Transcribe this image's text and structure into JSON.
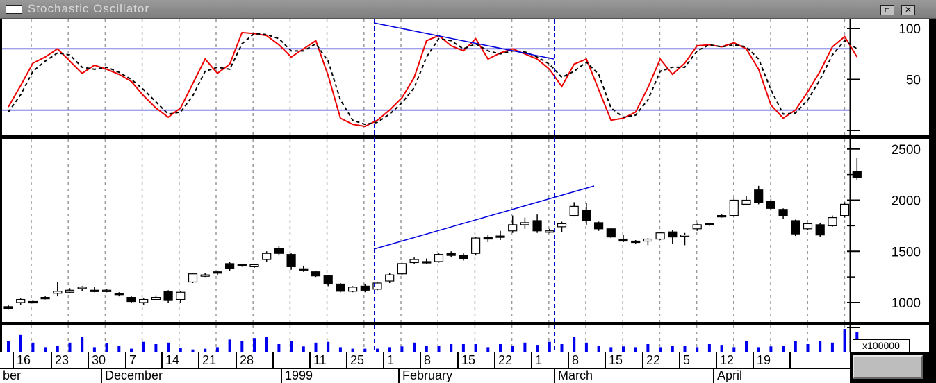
{
  "window": {
    "title": "Stochastic Oscillator",
    "restore_symbol": "▫",
    "close_symbol": "✕"
  },
  "colors": {
    "k_line": "#ee0000",
    "d_line": "#000000",
    "levels": "#0000cc",
    "trendline": "#0000dd",
    "volume": "#0000ee",
    "grid": "#9a9a9a"
  },
  "date_axis": {
    "days": [
      "16",
      "23",
      "30",
      "7",
      "14",
      "21",
      "28",
      "",
      "11",
      "25",
      "1",
      "8",
      "15",
      "22",
      "1",
      "8",
      "15",
      "22",
      "5",
      "12",
      "19",
      ""
    ],
    "months": [
      "ber",
      "December",
      "1999",
      "February",
      "March",
      "April"
    ]
  },
  "volume_unit": "x100000",
  "chart_data": [
    {
      "type": "line",
      "xlabel": "",
      "ylabel": "",
      "ylim": [
        0,
        100
      ],
      "ticks": [
        50,
        100
      ],
      "levels": [
        80,
        20
      ],
      "x_start_date": "1998-11-09",
      "series": [
        {
          "name": "",
          "style": "solid red",
          "values": [
            23,
            44,
            66,
            72,
            80,
            68,
            56,
            64,
            60,
            55,
            48,
            34,
            22,
            13,
            22,
            46,
            70,
            56,
            65,
            96,
            95,
            93,
            84,
            72,
            80,
            88,
            54,
            12,
            6,
            4,
            10,
            20,
            32,
            52,
            88,
            93,
            83,
            78,
            90,
            70,
            76,
            80,
            75,
            70,
            60,
            43,
            65,
            70,
            40,
            10,
            12,
            18,
            42,
            70,
            55,
            66,
            83,
            84,
            82,
            86,
            80,
            60,
            25,
            12,
            20,
            38,
            58,
            82,
            92,
            72
          ]
        },
        {
          "name": "",
          "style": "dashed black",
          "values": [
            18,
            35,
            58,
            68,
            76,
            74,
            62,
            60,
            62,
            57,
            50,
            40,
            28,
            16,
            18,
            34,
            58,
            62,
            60,
            85,
            95,
            94,
            90,
            78,
            78,
            85,
            68,
            30,
            10,
            6,
            8,
            16,
            27,
            42,
            72,
            90,
            88,
            80,
            85,
            78,
            75,
            78,
            77,
            72,
            65,
            52,
            58,
            67,
            55,
            22,
            13,
            15,
            30,
            58,
            62,
            62,
            78,
            84,
            82,
            84,
            82,
            70,
            40,
            16,
            17,
            30,
            50,
            74,
            88,
            80
          ]
        }
      ]
    },
    {
      "type": "bar",
      "subtype": "candlestick",
      "xlabel": "",
      "ylabel": "",
      "ylim": [
        750,
        2550
      ],
      "ticks": [
        1000,
        1500,
        2000,
        2500
      ],
      "x_start_date": "1998-11-09",
      "series": [
        {
          "name": "",
          "values": [
            [
              960,
              980,
              930,
              940
            ],
            [
              1000,
              1040,
              980,
              1030
            ],
            [
              1010,
              1020,
              990,
              1000
            ],
            [
              1050,
              1060,
              1030,
              1050
            ],
            [
              1090,
              1200,
              1060,
              1110
            ],
            [
              1100,
              1140,
              1090,
              1120
            ],
            [
              1140,
              1160,
              1110,
              1150
            ],
            [
              1120,
              1150,
              1100,
              1110
            ],
            [
              1110,
              1130,
              1100,
              1120
            ],
            [
              1090,
              1100,
              1060,
              1080
            ],
            [
              1050,
              1060,
              1000,
              1010
            ],
            [
              1000,
              1040,
              980,
              1030
            ],
            [
              1030,
              1070,
              1020,
              1050
            ],
            [
              1110,
              1120,
              1000,
              1020
            ],
            [
              1030,
              1110,
              1000,
              1100
            ],
            [
              1200,
              1290,
              1190,
              1280
            ],
            [
              1260,
              1290,
              1250,
              1270
            ],
            [
              1300,
              1310,
              1270,
              1290
            ],
            [
              1380,
              1400,
              1310,
              1330
            ],
            [
              1370,
              1380,
              1350,
              1360
            ],
            [
              1350,
              1380,
              1340,
              1370
            ],
            [
              1420,
              1500,
              1400,
              1480
            ],
            [
              1530,
              1550,
              1460,
              1480
            ],
            [
              1470,
              1480,
              1320,
              1350
            ],
            [
              1330,
              1360,
              1300,
              1320
            ],
            [
              1300,
              1310,
              1250,
              1260
            ],
            [
              1260,
              1270,
              1160,
              1180
            ],
            [
              1180,
              1190,
              1100,
              1110
            ],
            [
              1110,
              1160,
              1100,
              1150
            ],
            [
              1160,
              1180,
              1100,
              1120
            ],
            [
              1130,
              1200,
              1120,
              1190
            ],
            [
              1210,
              1290,
              1190,
              1270
            ],
            [
              1280,
              1390,
              1270,
              1380
            ],
            [
              1390,
              1440,
              1380,
              1420
            ],
            [
              1400,
              1430,
              1380,
              1390
            ],
            [
              1400,
              1480,
              1390,
              1470
            ],
            [
              1480,
              1500,
              1440,
              1460
            ],
            [
              1460,
              1480,
              1410,
              1430
            ],
            [
              1480,
              1640,
              1460,
              1630
            ],
            [
              1640,
              1660,
              1590,
              1620
            ],
            [
              1650,
              1700,
              1610,
              1640
            ],
            [
              1700,
              1850,
              1680,
              1760
            ],
            [
              1760,
              1830,
              1720,
              1780
            ],
            [
              1800,
              1860,
              1680,
              1700
            ],
            [
              1700,
              1720,
              1680,
              1700
            ],
            [
              1740,
              1790,
              1690,
              1770
            ],
            [
              1850,
              1980,
              1840,
              1940
            ],
            [
              1900,
              1970,
              1760,
              1800
            ],
            [
              1780,
              1790,
              1700,
              1720
            ],
            [
              1720,
              1730,
              1630,
              1640
            ],
            [
              1620,
              1660,
              1590,
              1600
            ],
            [
              1600,
              1610,
              1570,
              1590
            ],
            [
              1600,
              1630,
              1560,
              1620
            ],
            [
              1620,
              1690,
              1610,
              1680
            ],
            [
              1690,
              1710,
              1570,
              1640
            ],
            [
              1650,
              1680,
              1560,
              1660
            ],
            [
              1720,
              1770,
              1700,
              1760
            ],
            [
              1770,
              1780,
              1750,
              1760
            ],
            [
              1840,
              1860,
              1830,
              1850
            ],
            [
              1850,
              2020,
              1830,
              2000
            ],
            [
              1960,
              2040,
              1960,
              2000
            ],
            [
              2100,
              2140,
              1960,
              1980
            ],
            [
              1990,
              2010,
              1900,
              1920
            ],
            [
              1910,
              1920,
              1820,
              1850
            ],
            [
              1800,
              1810,
              1650,
              1670
            ],
            [
              1720,
              1780,
              1710,
              1770
            ],
            [
              1760,
              1780,
              1640,
              1660
            ],
            [
              1750,
              1850,
              1740,
              1830
            ],
            [
              1850,
              1980,
              1830,
              1960
            ],
            [
              2280,
              2410,
              2200,
              2220
            ]
          ]
        }
      ]
    },
    {
      "type": "bar",
      "subtype": "volume",
      "ylabel": "x100000",
      "values": [
        14,
        22,
        12,
        6,
        8,
        12,
        20,
        6,
        11,
        8,
        4,
        13,
        10,
        12,
        5,
        3,
        4,
        6,
        16,
        14,
        18,
        20,
        10,
        14,
        7,
        12,
        13,
        6,
        4,
        4,
        4,
        6,
        7,
        12,
        8,
        8,
        10,
        10,
        10,
        6,
        10,
        8,
        12,
        9,
        13,
        10,
        20,
        12,
        8,
        6,
        7,
        6,
        10,
        6,
        8,
        8,
        6,
        10,
        9,
        6,
        14,
        6,
        7,
        8,
        14,
        10,
        14,
        12,
        30,
        26
      ]
    }
  ]
}
